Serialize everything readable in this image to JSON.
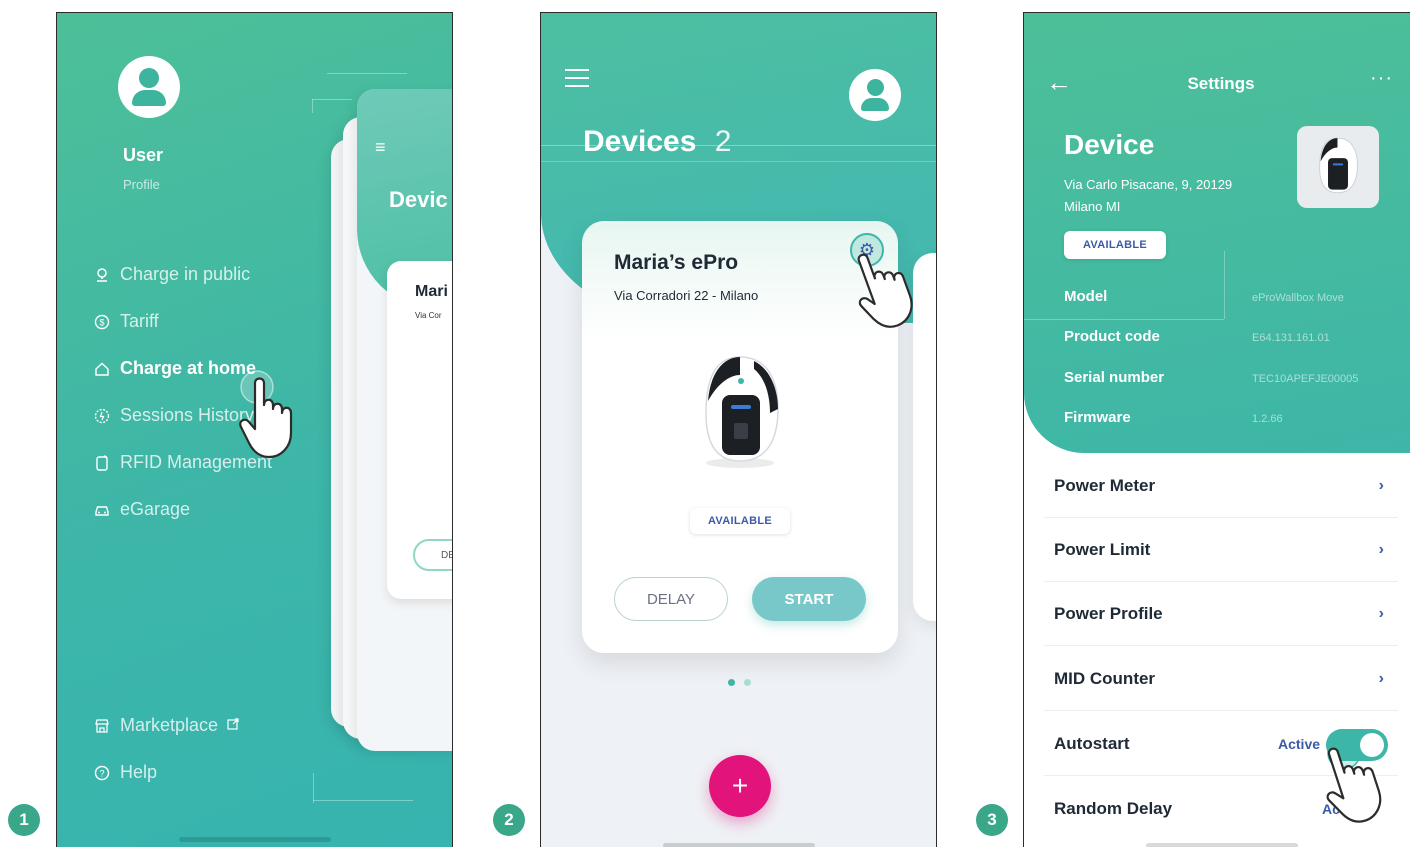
{
  "steps": [
    "1",
    "2",
    "3"
  ],
  "screen1": {
    "user_name": "User",
    "user_subtitle": "Profile",
    "menu": [
      {
        "label": "Charge in public",
        "icon": "map-pin-icon"
      },
      {
        "label": "Tariff",
        "icon": "dollar-circle-icon"
      },
      {
        "label": "Charge at home",
        "icon": "home-icon"
      },
      {
        "label": "Sessions History",
        "icon": "history-icon"
      },
      {
        "label": "RFID Management",
        "icon": "rfid-card-icon"
      },
      {
        "label": "eGarage",
        "icon": "car-icon"
      }
    ],
    "marketplace_label": "Marketplace",
    "help_label": "Help",
    "preview": {
      "title": "Devic",
      "card_name": "Mari",
      "card_address": "Via Cor",
      "delay_short": "DE"
    }
  },
  "screen2": {
    "title": "Devices",
    "count": "2",
    "device": {
      "name": "Maria’s ePro",
      "address": "Via Corradori 22 - Milano",
      "status": "AVAILABLE",
      "delay_label": "DELAY",
      "start_label": "START"
    },
    "fab_label": "+"
  },
  "screen3": {
    "header_title": "Settings",
    "device_title": "Device",
    "address_line1": "Via Carlo Pisacane, 9, 20129",
    "address_line2": "Milano MI",
    "status": "AVAILABLE",
    "specs": [
      {
        "label": "Model",
        "value": "eProWallbox Move"
      },
      {
        "label": "Product code",
        "value": "E64.131.161.01"
      },
      {
        "label": "Serial number",
        "value": "TEC10APEFJE00005"
      },
      {
        "label": "Firmware",
        "value": "1.2.66"
      }
    ],
    "settings": [
      {
        "label": "Power Meter"
      },
      {
        "label": "Power Limit"
      },
      {
        "label": "Power Profile"
      },
      {
        "label": "MID Counter"
      },
      {
        "label": "Autostart",
        "state": "Active"
      },
      {
        "label": "Random Delay",
        "state": "Activ"
      }
    ]
  },
  "colors": {
    "teal": "#3db6a8",
    "green": "#4dbf98",
    "accent_blue": "#3d5aa8",
    "fab_pink": "#e2137a",
    "step_green": "#3aa78a"
  }
}
